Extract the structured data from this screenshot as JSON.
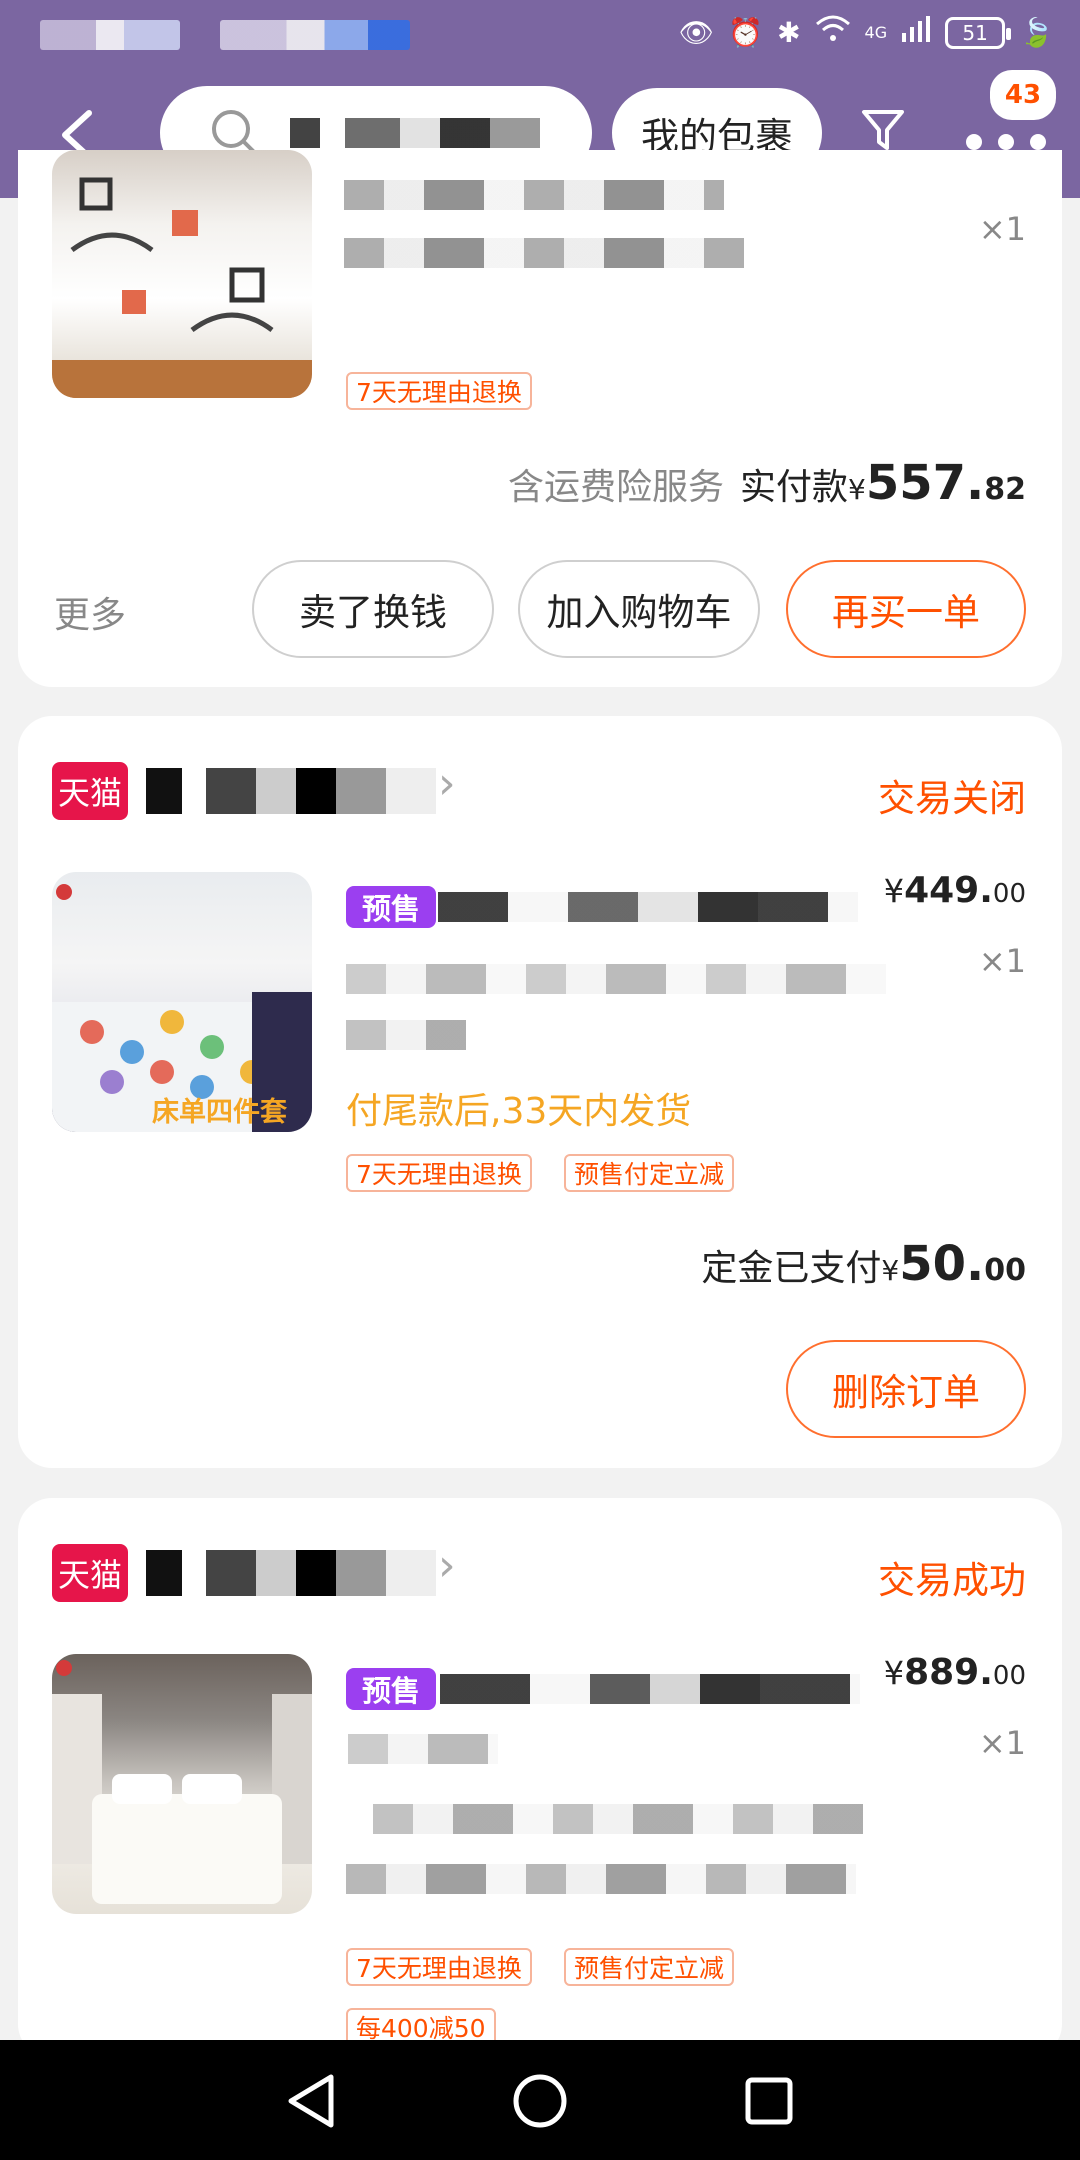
{
  "status_bar": {
    "battery": "51",
    "network": "4G"
  },
  "header": {
    "parcel_button": "我的包裹",
    "more_badge": "43"
  },
  "orders": [
    {
      "tag": "7天无理由退换",
      "qty": "×1",
      "insurance_note": "含运费险服务",
      "paid_label": "实付款",
      "currency": "¥",
      "paid_int": "557.",
      "paid_dec": "82",
      "more": "更多",
      "buttons": [
        "卖了换钱",
        "加入购物车",
        "再买一单"
      ]
    },
    {
      "shop_badge": "天猫",
      "status": "交易关闭",
      "presale": "预售",
      "price_int": "449.",
      "price_dec": "00",
      "qty": "×1",
      "thumb_caption": "床单四件套",
      "notice": "付尾款后,33天内发货",
      "tags": [
        "7天无理由退换",
        "预售付定立减"
      ],
      "deposit_label": "定金已支付",
      "deposit_int": "50.",
      "deposit_dec": "00",
      "button": "删除订单"
    },
    {
      "shop_badge": "天猫",
      "status": "交易成功",
      "presale": "预售",
      "price_int": "889.",
      "price_dec": "00",
      "qty": "×1",
      "tags": [
        "7天无理由退换",
        "预售付定立减",
        "每400减50"
      ]
    }
  ],
  "colors": {
    "header": "#7b66a1",
    "accent": "#ff5000",
    "tmall": "#e6154a",
    "presale": "#9b3ff0"
  }
}
